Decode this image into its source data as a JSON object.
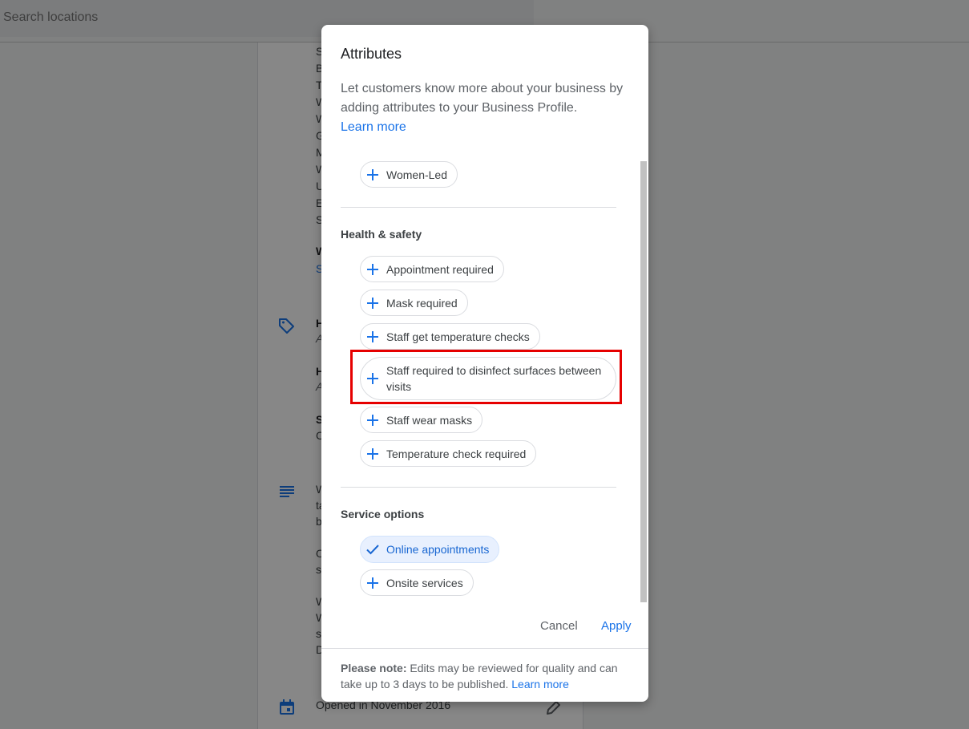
{
  "search": {
    "placeholder": "Search locations"
  },
  "background": {
    "lines": [
      "S",
      "B",
      "T",
      "W",
      "W",
      "G",
      "M",
      "W",
      "U",
      "E",
      "S"
    ],
    "bold_w": "W",
    "link_s": "S",
    "h1": "H",
    "h1_sub": "A",
    "h2": "H",
    "h2_sub": "A",
    "s_bold": "S",
    "s_sub": "C",
    "desc_lines": [
      "W",
      "ta",
      "b",
      "",
      "O",
      "s",
      "",
      "W",
      "W",
      "s",
      "D"
    ],
    "opened": "Opened in November 2016"
  },
  "dialog": {
    "title": "Attributes",
    "description": "Let customers know more about your business by adding attributes to your Business Profile.",
    "learn_more": "Learn more",
    "chip_women_led": "Women-Led",
    "health_title": "Health & safety",
    "health_chips": [
      "Appointment required",
      "Mask required",
      "Staff get temperature checks",
      "Staff required to disinfect surfaces between visits",
      "Staff wear masks",
      "Temperature check required"
    ],
    "service_title": "Service options",
    "service_chips": [
      {
        "label": "Online appointments",
        "selected": true
      },
      {
        "label": "Onsite services",
        "selected": false
      }
    ],
    "cancel": "Cancel",
    "apply": "Apply",
    "note_label": "Please note:",
    "note_text": " Edits may be reviewed for quality and can take up to 3 days to be published. ",
    "note_link": "Learn more"
  },
  "icons": {
    "add": "plus-icon",
    "selected": "check-icon"
  },
  "colors": {
    "accent": "#1a73e8",
    "highlight": "#e60000",
    "chip_selected_bg": "#e8f0fe"
  }
}
